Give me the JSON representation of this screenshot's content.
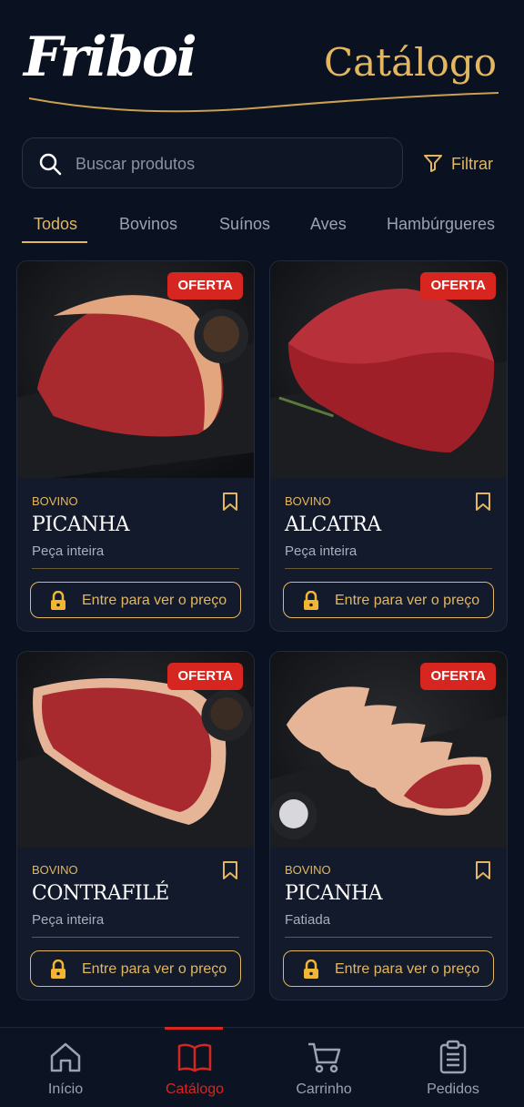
{
  "brand": "Friboi",
  "header": {
    "title": "Catálogo"
  },
  "search": {
    "placeholder": "Buscar produtos"
  },
  "filter": {
    "label": "Filtrar"
  },
  "tabs": [
    "Todos",
    "Bovinos",
    "Suínos",
    "Aves",
    "Hambúrgueres"
  ],
  "active_tab": "Todos",
  "products": [
    {
      "badge": "OFERTA",
      "category": "BOVINO",
      "name": "PICANHA",
      "subtitle": "Peça inteira",
      "cta": "Entre para ver o preço"
    },
    {
      "badge": "OFERTA",
      "category": "BOVINO",
      "name": "ALCATRA",
      "subtitle": "Peça inteira",
      "cta": "Entre para ver o preço"
    },
    {
      "badge": "OFERTA",
      "category": "BOVINO",
      "name": "CONTRAFILÉ",
      "subtitle": "Peça inteira",
      "cta": "Entre para ver o preço"
    },
    {
      "badge": "OFERTA",
      "category": "BOVINO",
      "name": "PICANHA",
      "subtitle": "Fatiada",
      "cta": "Entre para ver o preço"
    }
  ],
  "nav": [
    {
      "label": "Início",
      "icon": "home-icon"
    },
    {
      "label": "Catálogo",
      "icon": "book-icon"
    },
    {
      "label": "Carrinho",
      "icon": "cart-icon"
    },
    {
      "label": "Pedidos",
      "icon": "clipboard-icon"
    }
  ],
  "active_nav": "Catálogo",
  "colors": {
    "background": "#0a1120",
    "gold": "#e3b760",
    "red": "#d7261f",
    "card": "#121a2b"
  }
}
